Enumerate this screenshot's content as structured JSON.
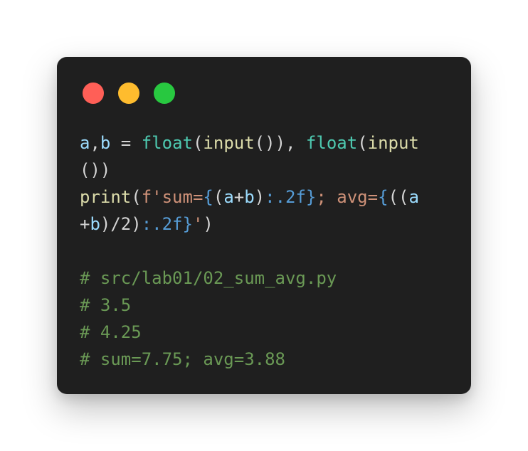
{
  "window": {
    "controls": {
      "close_color": "#ff5f57",
      "minimize_color": "#febc2e",
      "maximize_color": "#28c840"
    }
  },
  "code": {
    "language": "python",
    "lines": [
      [
        {
          "t": "a",
          "k": "var"
        },
        {
          "t": ",",
          "k": "punct"
        },
        {
          "t": "b",
          "k": "var"
        },
        {
          "t": " = ",
          "k": "op"
        },
        {
          "t": "float",
          "k": "builtin"
        },
        {
          "t": "(",
          "k": "punct"
        },
        {
          "t": "input",
          "k": "func"
        },
        {
          "t": "()), ",
          "k": "punct"
        },
        {
          "t": "float",
          "k": "builtin"
        },
        {
          "t": "(",
          "k": "punct"
        },
        {
          "t": "input",
          "k": "func"
        }
      ],
      [
        {
          "t": "())",
          "k": "punct"
        }
      ],
      [
        {
          "t": "print",
          "k": "func"
        },
        {
          "t": "(",
          "k": "punct"
        },
        {
          "t": "f'sum=",
          "k": "str"
        },
        {
          "t": "{",
          "k": "brace"
        },
        {
          "t": "(",
          "k": "punct"
        },
        {
          "t": "a",
          "k": "var"
        },
        {
          "t": "+",
          "k": "op"
        },
        {
          "t": "b",
          "k": "var"
        },
        {
          "t": ")",
          "k": "punct"
        },
        {
          "t": ":.2f",
          "k": "fmt"
        },
        {
          "t": "}",
          "k": "brace"
        },
        {
          "t": "; avg=",
          "k": "str"
        },
        {
          "t": "{",
          "k": "brace"
        },
        {
          "t": "((",
          "k": "punct"
        },
        {
          "t": "a",
          "k": "var"
        }
      ],
      [
        {
          "t": "+",
          "k": "op"
        },
        {
          "t": "b",
          "k": "var"
        },
        {
          "t": ")/2)",
          "k": "punct"
        },
        {
          "t": ":.2f",
          "k": "fmt"
        },
        {
          "t": "}",
          "k": "brace"
        },
        {
          "t": "'",
          "k": "str"
        },
        {
          "t": ")",
          "k": "punct"
        }
      ],
      [],
      [
        {
          "t": "# src/lab01/02_sum_avg.py",
          "k": "comment"
        }
      ],
      [
        {
          "t": "# 3.5",
          "k": "comment"
        }
      ],
      [
        {
          "t": "# 4.25",
          "k": "comment"
        }
      ],
      [
        {
          "t": "# sum=7.75; avg=3.88",
          "k": "comment"
        }
      ]
    ]
  }
}
